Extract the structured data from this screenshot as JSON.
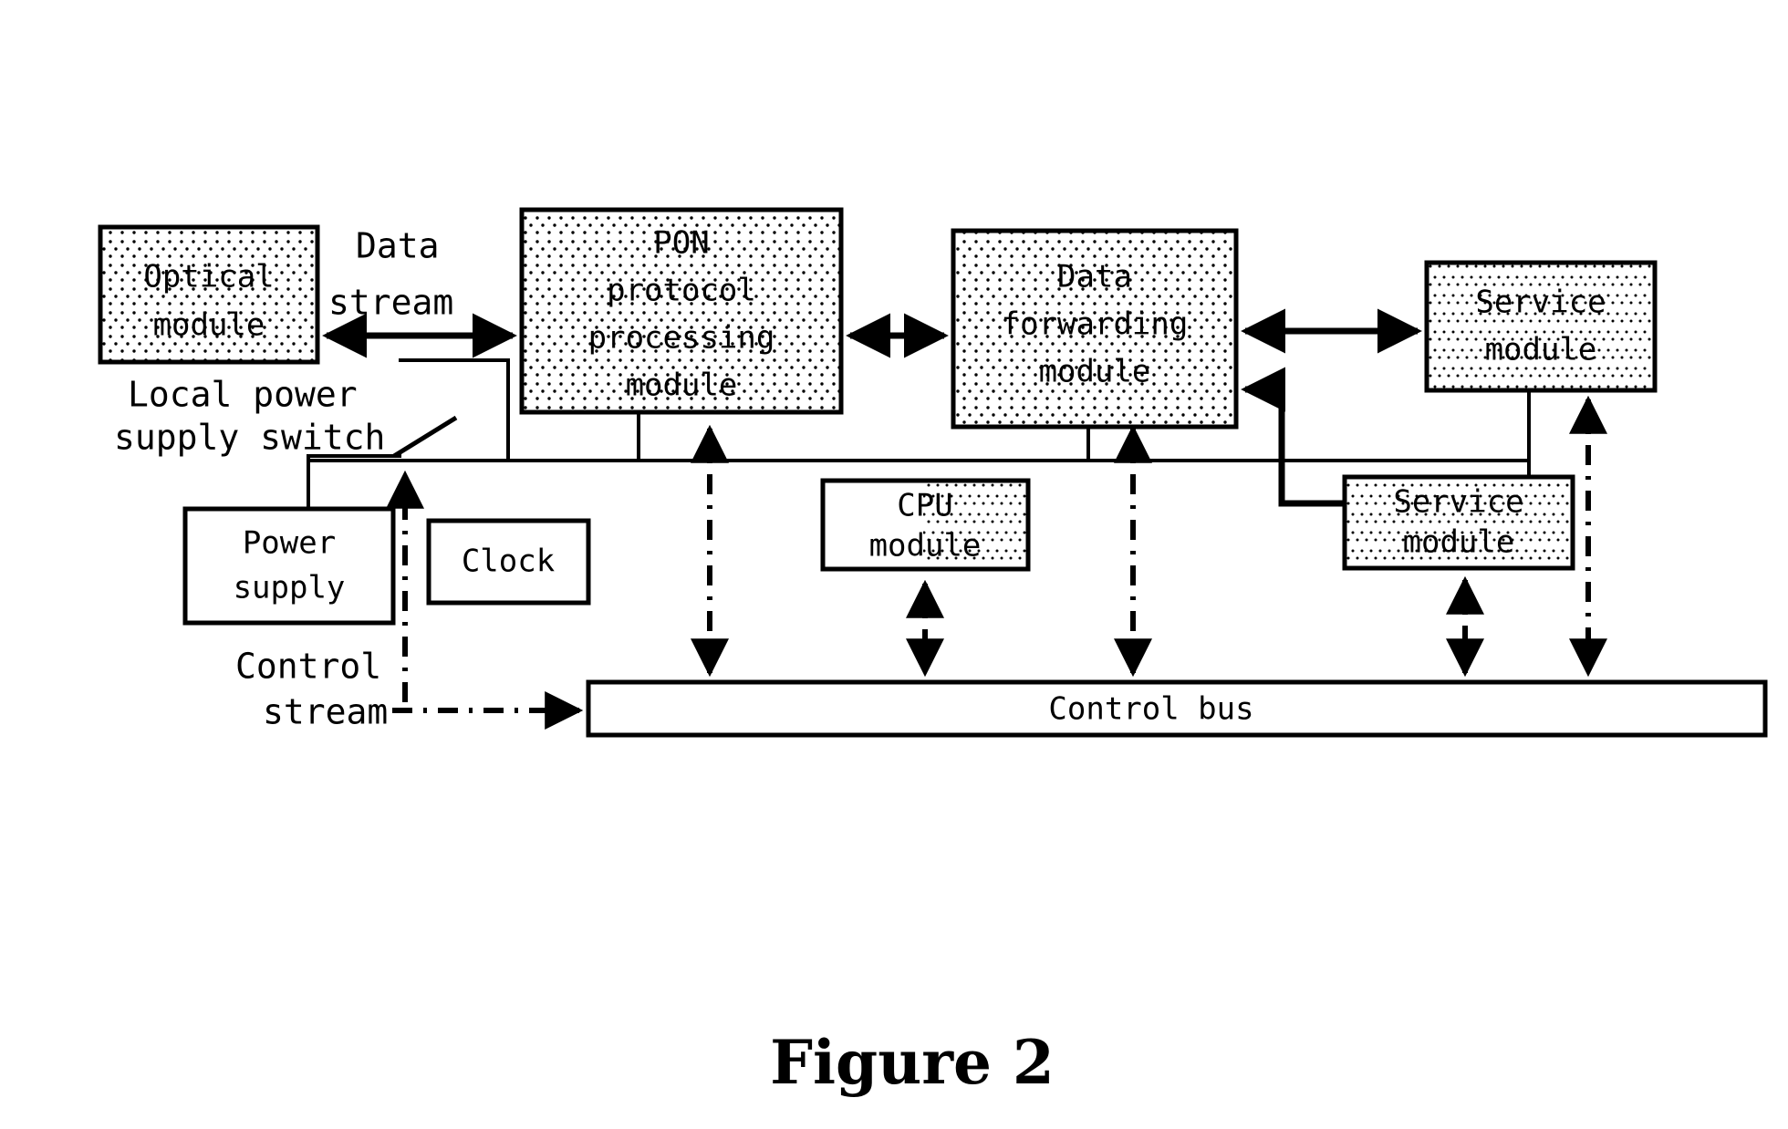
{
  "figure": {
    "caption": "Figure 2",
    "type": "block-diagram"
  },
  "boxes": {
    "optical_module": {
      "line1": "Optical",
      "line2": "module"
    },
    "pon_module": {
      "line1": "PON",
      "line2": "protocol",
      "line3": "processing",
      "line4": "module"
    },
    "data_forwarding_module": {
      "line1": "Data",
      "line2": "forwarding",
      "line3": "module"
    },
    "service_module_top": {
      "line1": "Service",
      "line2": "module"
    },
    "service_module_bottom": {
      "line1": "Service",
      "line2": "module"
    },
    "cpu_module": {
      "line1": "CPU",
      "line2": "module"
    },
    "power_supply": {
      "line1": "Power",
      "line2": "supply"
    },
    "clock": {
      "line1": "Clock"
    },
    "control_bus": {
      "label": "Control bus"
    }
  },
  "annotations": {
    "data_stream": {
      "line1": "Data",
      "line2": "stream"
    },
    "local_power_switch": {
      "line1": "Local power",
      "line2": "supply switch"
    },
    "control_stream": {
      "line1": "Control",
      "line2": "stream"
    }
  },
  "colors": {
    "ink": "#000000",
    "paper": "#ffffff",
    "fill_dotted": "#ffffff"
  }
}
